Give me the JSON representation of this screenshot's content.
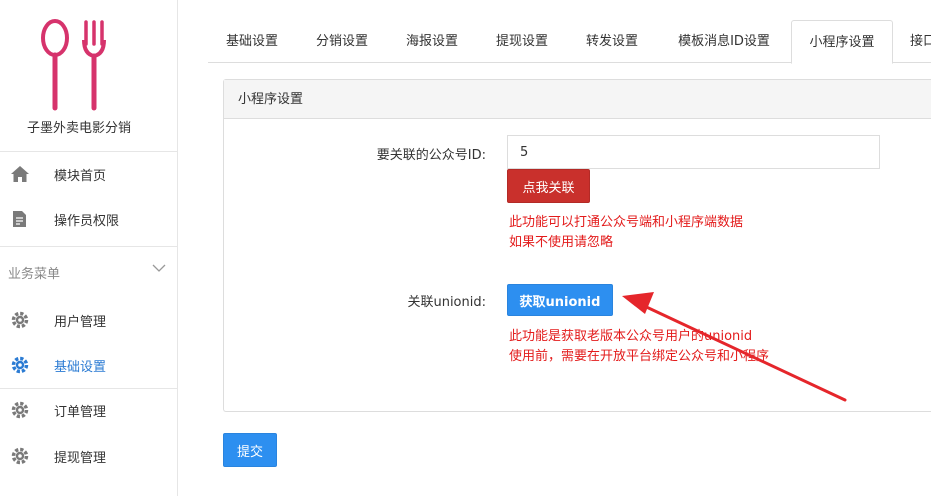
{
  "sidebar": {
    "logo_text": "子墨外卖电影分销",
    "nav_top": [
      {
        "label": "模块首页",
        "icon": "home-icon"
      },
      {
        "label": "操作员权限",
        "icon": "document-edit-icon"
      }
    ],
    "section_title": "业务菜单",
    "nav_menu": [
      {
        "label": "用户管理",
        "icon": "gear-icon"
      },
      {
        "label": "基础设置",
        "icon": "gear-icon",
        "active": true
      },
      {
        "label": "订单管理",
        "icon": "gear-icon"
      },
      {
        "label": "提现管理",
        "icon": "gear-icon"
      }
    ]
  },
  "tabs": [
    "基础设置",
    "分销设置",
    "海报设置",
    "提现设置",
    "转发设置",
    "模板消息ID设置",
    "小程序设置",
    "接口"
  ],
  "active_tab": "小程序设置",
  "panel": {
    "title": "小程序设置",
    "official_id_label": "要关联的公众号ID:",
    "official_id_value": "5",
    "link_button": "点我关联",
    "link_help": [
      "此功能可以打通公众号端和小程序端数据",
      "如果不使用请忽略"
    ],
    "unionid_label": "关联unionid:",
    "unionid_button": "获取unionid",
    "unionid_help": [
      "此功能是获取老版本公众号用户的unionid",
      "使用前，需要在开放平台绑定公众号和小程序"
    ]
  },
  "submit_button": "提交",
  "colors": {
    "primary": "#2d8ff0",
    "danger": "#c9302c",
    "help_text": "#e31b1b",
    "active_nav": "#2b7bd3",
    "logo": "#d6336c"
  }
}
